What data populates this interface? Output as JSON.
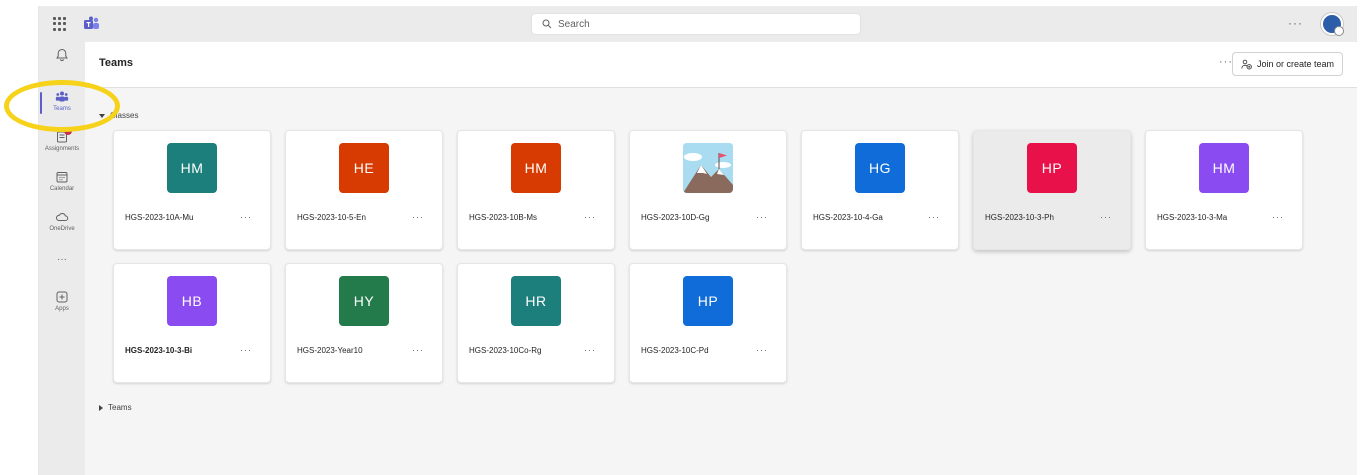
{
  "topbar": {
    "search_placeholder": "Search",
    "more": "···"
  },
  "rail": {
    "items": [
      {
        "label": "",
        "icon": "bell-icon"
      },
      {
        "label": "Teams",
        "icon": "teams-icon"
      },
      {
        "label": "Assignments",
        "icon": "assignments-icon"
      },
      {
        "label": "Calendar",
        "icon": "calendar-icon"
      },
      {
        "label": "OneDrive",
        "icon": "cloud-icon"
      },
      {
        "label": "···",
        "icon": "more-icon"
      },
      {
        "label": "Apps",
        "icon": "apps-icon"
      }
    ]
  },
  "header": {
    "title": "Teams",
    "more": "···",
    "join_label": "Join or create team"
  },
  "sections": {
    "classes": "Classes",
    "teams": "Teams"
  },
  "colors": {
    "accent": "#5b5fc7",
    "highlight": "#f6d21a"
  },
  "cards": [
    {
      "initials": "HM",
      "name": "HGS-2023-10A-Mu",
      "color": "#1d7f7c"
    },
    {
      "initials": "HE",
      "name": "HGS-2023-10-5-En",
      "color": "#d83b01"
    },
    {
      "initials": "HM",
      "name": "HGS-2023-10B-Ms",
      "color": "#d83b01"
    },
    {
      "initials": "",
      "name": "HGS-2023-10D-Gg",
      "color": "#9fd4ea",
      "image": true
    },
    {
      "initials": "HG",
      "name": "HGS-2023-10-4-Ga",
      "color": "#0f6cd8"
    },
    {
      "initials": "HP",
      "name": "HGS-2023-10-3-Ph",
      "color": "#e8114a",
      "hover": true
    },
    {
      "initials": "HM",
      "name": "HGS-2023-10-3-Ma",
      "color": "#8a4bf0"
    },
    {
      "initials": "HB",
      "name": "HGS-2023-10-3-Bi",
      "color": "#8a4bf0",
      "bold": true
    },
    {
      "initials": "HY",
      "name": "HGS-2023-Year10",
      "color": "#237b4b"
    },
    {
      "initials": "HR",
      "name": "HGS-2023-10Co-Rg",
      "color": "#1d7f7c"
    },
    {
      "initials": "HP",
      "name": "HGS-2023-10C-Pd",
      "color": "#0f6cd8"
    }
  ],
  "card_more": "···"
}
